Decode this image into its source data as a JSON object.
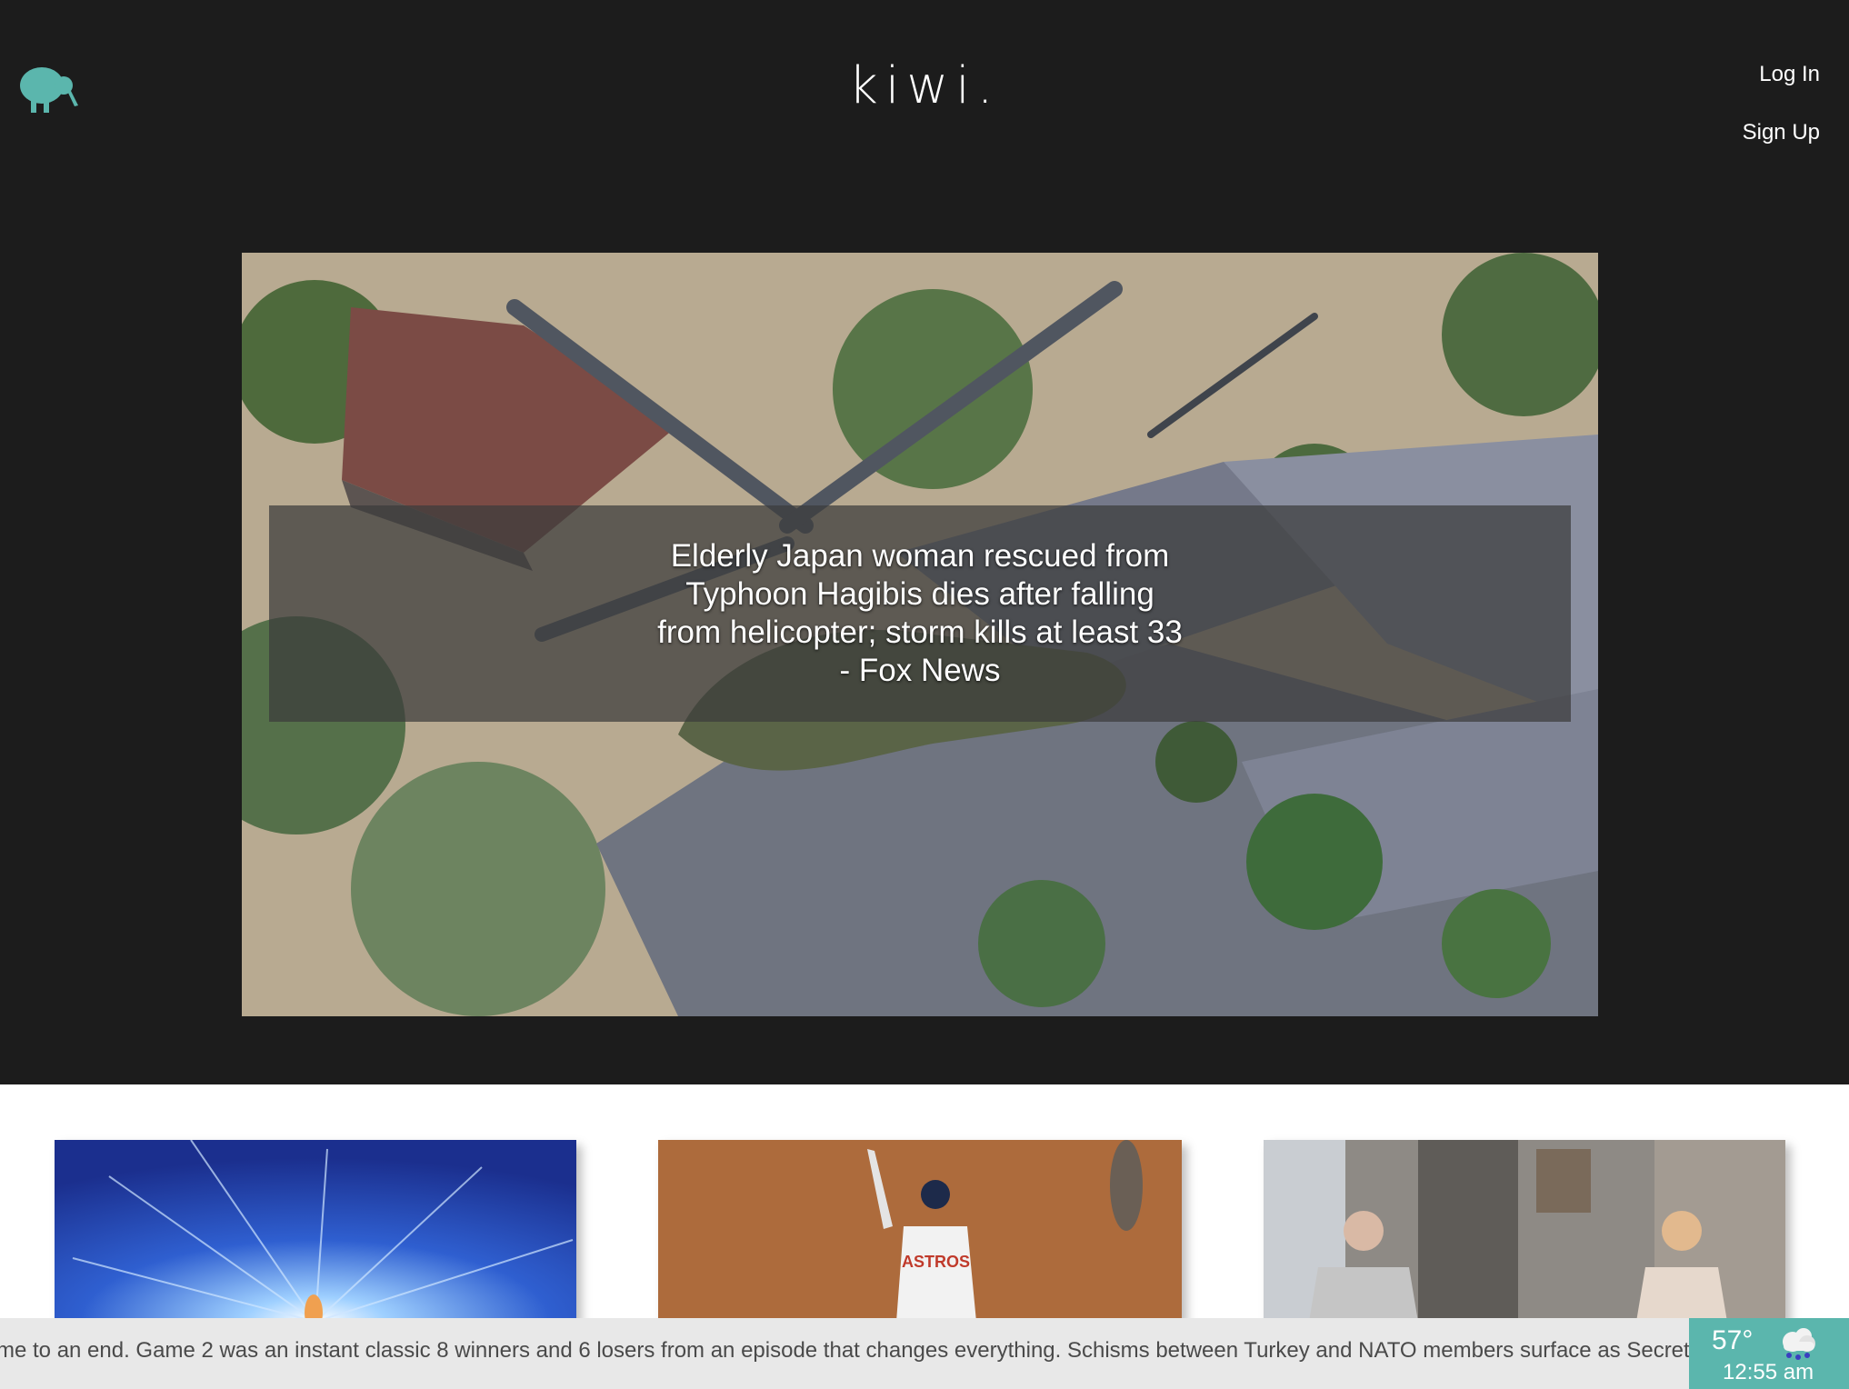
{
  "header": {
    "brand": "kiwi.",
    "login_label": "Log In",
    "signup_label": "Sign Up",
    "logo_icon": "kiwi-bird-icon",
    "accent_color": "#5bb6ad"
  },
  "hero": {
    "headline": "Elderly Japan woman rescued from Typhoon Hagibis dies after falling from helicopter; storm kills at least 33 - Fox News",
    "image": "flood-rescue-helicopter-photo"
  },
  "cards": [
    {
      "image": "blue-energy-burst-photo"
    },
    {
      "image": "baseball-player-astros-photo"
    },
    {
      "image": "tv-scene-living-room-photo"
    }
  ],
  "ticker": {
    "text": "me to an end. Game 2 was an instant classic 8 winners and 6 losers from an episode that changes everything. Schisms between Turkey and NATO members surface as Secreta"
  },
  "weather": {
    "temperature": "57°",
    "time": "12:55 am",
    "icon": "snow-cloud-icon"
  }
}
